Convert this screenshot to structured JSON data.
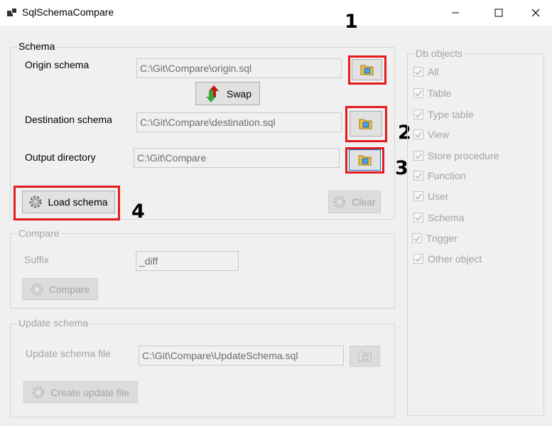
{
  "window": {
    "title": "SqlSchemaCompare",
    "controls": {
      "minimize": "minimize",
      "maximize": "maximize",
      "close": "close"
    }
  },
  "schema_group": {
    "title": "Schema",
    "origin_label": "Origin schema",
    "origin_value": "C:\\Git\\Compare\\origin.sql",
    "swap_label": "Swap",
    "destination_label": "Destination schema",
    "destination_value": "C:\\Git\\Compare\\destination.sql",
    "output_label": "Output directory",
    "output_value": "C:\\Git\\Compare",
    "load_label": "Load schema",
    "clear_label": "Clear"
  },
  "compare_group": {
    "title": "Compare",
    "suffix_label": "Suffix",
    "suffix_value": "_diff",
    "compare_label": "Compare"
  },
  "update_group": {
    "title": "Update schema",
    "file_label": "Update schema file",
    "file_value": "C:\\Git\\Compare\\UpdateSchema.sql",
    "create_label": "Create update file"
  },
  "db_objects": {
    "title": "Db objects",
    "items": [
      {
        "label": "All",
        "checked": true
      },
      {
        "label": "Table",
        "checked": true
      },
      {
        "label": "Type table",
        "checked": true
      },
      {
        "label": "View",
        "checked": true
      },
      {
        "label": "Store procedure",
        "checked": true
      },
      {
        "label": "Function",
        "checked": true
      },
      {
        "label": "User",
        "checked": true
      },
      {
        "label": "Schema",
        "checked": true
      },
      {
        "label": "Trigger",
        "checked": true
      },
      {
        "label": "Other object",
        "checked": true
      }
    ]
  },
  "annotations": [
    "1",
    "2",
    "3",
    "4"
  ],
  "colors": {
    "highlight": "#e41b1b",
    "disabled_text": "#a3a3a3",
    "focus_border": "#0078d7"
  },
  "icons": {
    "browse": "folder-icon",
    "swap": "swap-arrows-icon",
    "gear": "gear-icon"
  }
}
